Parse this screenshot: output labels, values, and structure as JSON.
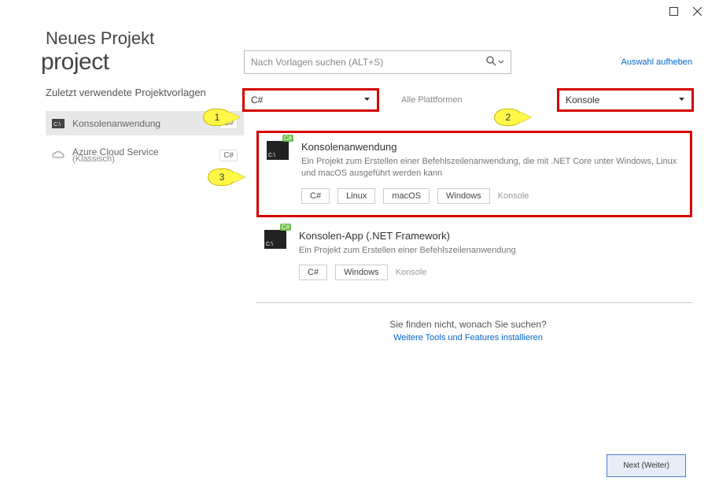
{
  "window": {
    "title": "Neues Projekt",
    "subtitle": "project"
  },
  "search": {
    "placeholder": "Nach Vorlagen suchen (ALT+S)",
    "clear_label": "Auswahl aufheben"
  },
  "filters": {
    "language": {
      "value": "C#"
    },
    "platform_label": "Alle Plattformen",
    "type": {
      "value": "Konsole"
    }
  },
  "callouts": {
    "c1": "1",
    "c2": "2",
    "c3": "3"
  },
  "recent": {
    "heading": "Zuletzt verwendete Projektvorlagen",
    "items": [
      {
        "name": "Konsolenanwendung",
        "lang": "C#"
      },
      {
        "name": "Azure Cloud Service",
        "lang": "C#",
        "sub": "(Klassisch)"
      }
    ]
  },
  "templates": [
    {
      "title": "Konsolenanwendung",
      "desc": "Ein Projekt zum Erstellen einer Befehlszeilenanwendung, die mit .NET Core unter Windows, Linux und macOS ausgeführt werden kann",
      "tags": [
        "C#",
        "Linux",
        "macOS",
        "Windows"
      ],
      "plain_tag": "Konsole"
    },
    {
      "title": "Konsolen-App (.NET Framework)",
      "desc": "Ein Projekt zum Erstellen einer Befehlszeilenanwendung",
      "tags": [
        "C#",
        "Windows"
      ],
      "plain_tag": "Konsole"
    }
  ],
  "notfound": {
    "question": "Sie finden nicht, wonach Sie suchen?",
    "link": "Weitere Tools und Features installieren"
  },
  "buttons": {
    "next": "Next (Weiter)"
  }
}
